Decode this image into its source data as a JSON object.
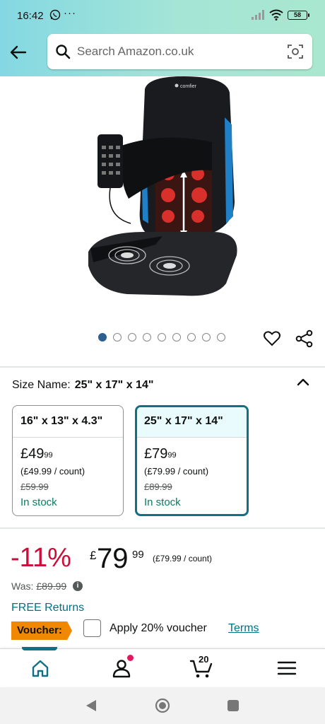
{
  "status_bar": {
    "time": "16:42",
    "extra": "···",
    "battery": "58"
  },
  "search": {
    "placeholder": "Search Amazon.co.uk"
  },
  "product_image": {
    "brand_text": "comfier"
  },
  "carousel": {
    "count": 9,
    "active_index": 0
  },
  "size": {
    "label": "Size Name:",
    "selected": "25\" x 17\" x 14\"",
    "options": [
      {
        "name": "16\" x 13\" x 4.3\"",
        "currency": "£",
        "whole": "49",
        "fraction": "99",
        "per_count": "(£49.99 / count)",
        "was": "£59.99",
        "stock": "In stock"
      },
      {
        "name": "25\" x 17\" x 14\"",
        "currency": "£",
        "whole": "79",
        "fraction": "99",
        "per_count": "(£79.99 / count)",
        "was": "£89.99",
        "stock": "In stock"
      }
    ]
  },
  "price": {
    "discount": "-11%",
    "currency": "£",
    "whole": "79",
    "fraction": "99",
    "per_count": "(£79.99 / count)",
    "was_label": "Was:",
    "was_value": "£89.99",
    "info_glyph": "i"
  },
  "returns": "FREE Returns",
  "voucher": {
    "tag": "Voucher:",
    "text": "Apply 20% voucher",
    "terms": "Terms"
  },
  "bottom_nav": {
    "cart_count": "20"
  },
  "colors": {
    "header_gradient_start": "#84d8e3",
    "header_gradient_end": "#a9e7cf",
    "discount_red": "#cc0c39",
    "link_teal": "#007185",
    "stock_green": "#067d62",
    "selected_border": "#127083",
    "voucher_orange": "#f08804"
  }
}
